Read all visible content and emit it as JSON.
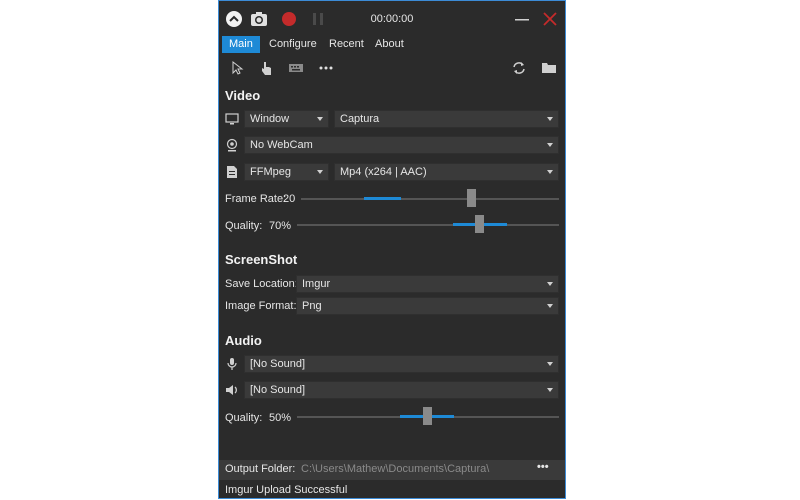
{
  "titlebar": {
    "timer": "00:00:00",
    "icons": [
      "collapse-icon",
      "camera-icon",
      "record-icon",
      "pause-icon",
      "minimize-icon",
      "close-icon"
    ]
  },
  "tabs": [
    "Main",
    "Configure",
    "Recent",
    "About"
  ],
  "toolbar": {
    "icons": [
      "cursor-icon",
      "click-icon",
      "keyboard-icon",
      "more-icon",
      "refresh-icon",
      "folder-icon"
    ]
  },
  "video": {
    "header": "Video",
    "source_type": "Window",
    "source": "Captura",
    "webcam": "No WebCam",
    "encoder": "FFMpeg",
    "format": "Mp4 (x264 | AAC)",
    "frame_rate_label": "Frame Rate:",
    "frame_rate_value": "20",
    "quality_label": "Quality:",
    "quality_value": "70%"
  },
  "screenshot": {
    "header": "ScreenShot",
    "save_location_label": "Save Location:",
    "save_location": "Imgur",
    "image_format_label": "Image Format:",
    "image_format": "Png"
  },
  "audio": {
    "header": "Audio",
    "mic": "[No Sound]",
    "speaker": "[No Sound]",
    "quality_label": "Quality:",
    "quality_value": "50%"
  },
  "output": {
    "label": "Output Folder:",
    "path": "C:\\Users\\Mathew\\Documents\\Captura\\",
    "more": "•••"
  },
  "status": "Imgur Upload Successful",
  "colors": {
    "accent": "#1e8ad6",
    "record": "#c42b2b",
    "window_bg": "#2b2b2b"
  },
  "sliders": {
    "frame_rate_level": 0.65,
    "video_quality_level": 0.7,
    "audio_quality_level": 0.5
  }
}
